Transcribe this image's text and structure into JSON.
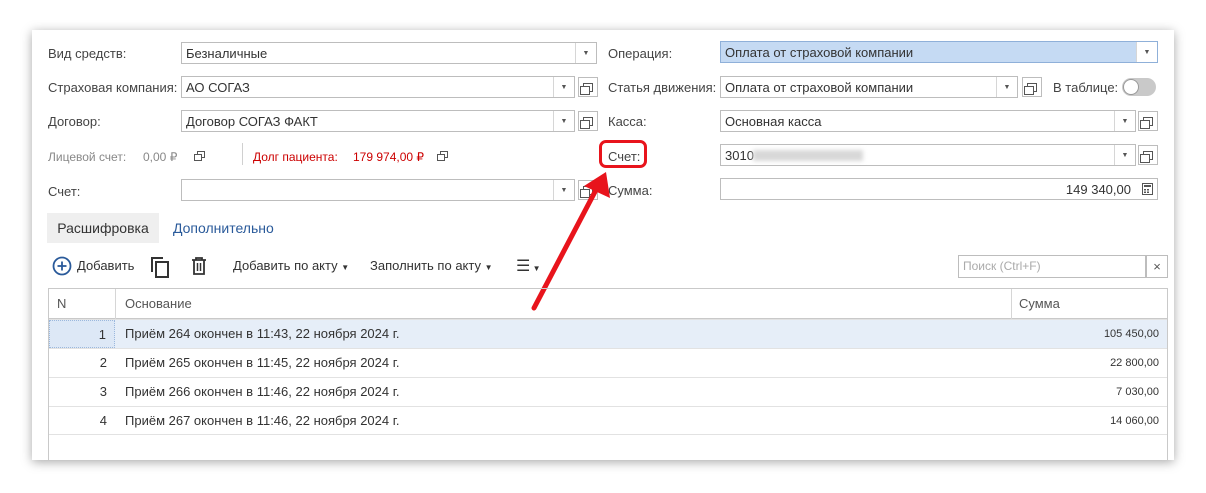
{
  "form": {
    "vid_label": "Вид средств:",
    "vid_value": "Безналичные",
    "company_label": "Страховая компания:",
    "company_value": "АО СОГАЗ",
    "contract_label": "Договор:",
    "contract_value": "Договор СОГАЗ ФАКТ",
    "personal_label": "Лицевой счет:",
    "personal_value": "0,00 ₽",
    "debt_label": "Долг пациента:",
    "debt_value": "179 974,00 ₽",
    "account_left_label": "Счет:",
    "account_left_value": "",
    "operation_label": "Операция:",
    "operation_value": "Оплата от страховой компании",
    "article_label": "Статья движения:",
    "article_value": "Оплата от страховой компании",
    "in_table_label": "В таблице:",
    "cash_label": "Касса:",
    "cash_value": "Основная касса",
    "account_label": "Счет:",
    "account_value": "3010",
    "sum_label": "Сумма:",
    "sum_value": "149 340,00"
  },
  "tabs": {
    "decoding": "Расшифровка",
    "additional": "Дополнительно"
  },
  "toolbar": {
    "add": "Добавить",
    "add_by_act": "Добавить по акту",
    "fill_by_act": "Заполнить по акту",
    "search_placeholder": "Поиск (Ctrl+F)"
  },
  "table": {
    "headers": [
      "N",
      "Основание",
      "Сумма"
    ],
    "rows": [
      {
        "n": "1",
        "basis": "Приём 264 окончен в 11:43, 22 ноября 2024 г.",
        "sum": "105 450,00"
      },
      {
        "n": "2",
        "basis": "Приём 265 окончен в 11:45, 22 ноября 2024 г.",
        "sum": "22 800,00"
      },
      {
        "n": "3",
        "basis": "Приём 266 окончен в 11:46, 22 ноября 2024 г.",
        "sum": "7 030,00"
      },
      {
        "n": "4",
        "basis": "Приём 267 окончен в 11:46, 22 ноября 2024 г.",
        "sum": "14 060,00"
      }
    ]
  },
  "colors": {
    "highlight_field": "#c5daf3",
    "selected_row": "#e6eef8",
    "debt": "#cc0000",
    "annotation": "#e8141c",
    "link": "#2a5a9a"
  }
}
